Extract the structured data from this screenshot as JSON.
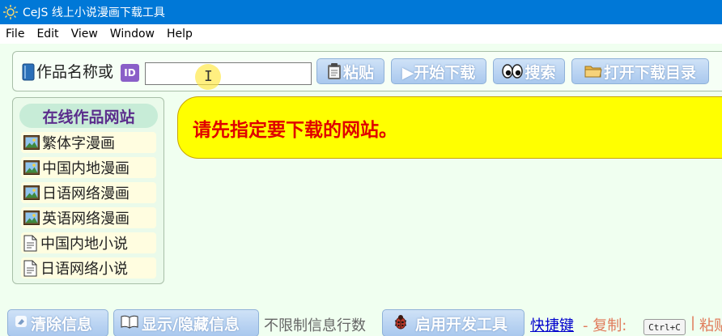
{
  "window": {
    "title": "CeJS 线上小说漫画下载工具"
  },
  "menu": [
    "File",
    "Edit",
    "View",
    "Window",
    "Help"
  ],
  "toolbar": {
    "name_label": "作品名称或",
    "id_badge": "ID",
    "input_value": "",
    "input_placeholder": "",
    "paste_label": "粘贴",
    "start_label": "▶开始下载",
    "search_label": "搜索",
    "open_dir_label": "打开下载目录"
  },
  "sidebar": {
    "title": "在线作品网站",
    "items": [
      {
        "label": "繁体字漫画",
        "icon": "image-icon"
      },
      {
        "label": "中国内地漫画",
        "icon": "image-icon"
      },
      {
        "label": "日语网络漫画",
        "icon": "image-icon"
      },
      {
        "label": "英语网络漫画",
        "icon": "image-icon"
      },
      {
        "label": "中国内地小说",
        "icon": "document-icon"
      },
      {
        "label": "日语网络小说",
        "icon": "document-icon"
      }
    ]
  },
  "message": "请先指定要下载的网站。",
  "bottom": {
    "clear_label": "清除信息",
    "toggle_label": "显示/隐藏信息",
    "unlimited_label": "不限制信息行数",
    "devtools_label": "启用开发工具",
    "shortcut_link": "快捷键",
    "copy_label": "- 复制:",
    "copy_key": "Ctrl+C",
    "separator": "|",
    "paste_label": "粘贴"
  },
  "colors": {
    "titlebar": "#0078d7",
    "background": "#f0fff0",
    "button_gradient_top": "#cfe2f7",
    "button_gradient_bottom": "#a9c8ee",
    "message_background": "#ffff00",
    "message_text": "#e00000",
    "sidebar_title_text": "#5b2d8c"
  }
}
